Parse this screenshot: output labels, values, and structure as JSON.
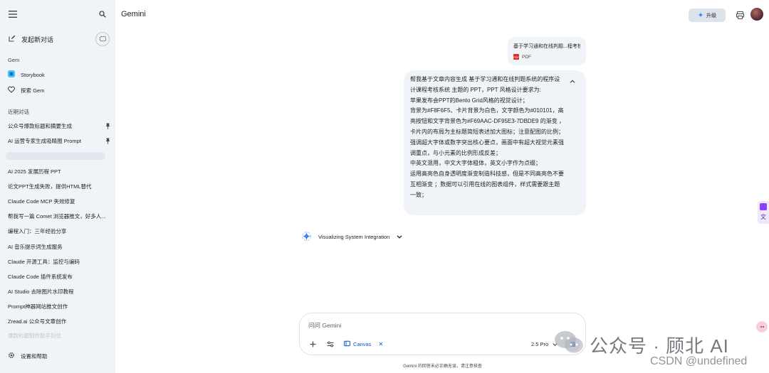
{
  "brand": "Gemini",
  "header": {
    "upgrade_label": "升级"
  },
  "sidebar": {
    "new_chat": "发起新对话",
    "gem_section": "Gem",
    "gems": [
      {
        "label": "Storybook"
      },
      {
        "label": "探索 Gem"
      }
    ],
    "recent_section": "近期对话",
    "pinned": [
      {
        "label": "公众号爆款标题和摘要生成"
      },
      {
        "label": "AI 运营专家生成吸睛图 Prompt"
      }
    ],
    "recent": [
      "AI 2025 发展历程 PPT",
      "论文PPT生成失败，提供HTML替代",
      "Claude Code MCP 失效修复",
      "帮我写一篇 Comet 浏览器推文，好多人...",
      "编程入门：三年经验分享",
      "AI 音乐提示词生成服务",
      "Claude 开源工具：监控与编码",
      "Claude Code 插件系统发布",
      "AI Studio 去除图片水印教程",
      "Prompt神器网站推文创作",
      "Zread.ai 公众号文章创作"
    ],
    "faded_item": "爆款标题制作助手封位",
    "settings": "设置和帮助"
  },
  "conversation": {
    "file": {
      "name": "基于学习通和在线判题...程考核",
      "type": "PDF"
    },
    "user_message": [
      "帮我基于文章内容生成 基于学习通和在线判题系统的程序设计课程考核系统 主题的 PPT，PPT 风格设计要求为:",
      "苹果发布会PPT的Bento Grid风格的视觉设计；",
      "背景为#F8F6F5、卡片背景为白色，文字颜色为#010101，高亮按钮和文字背景色为#F69AAC-DF95E3-7DBDE9 的渐变 ，卡片内的布局为主标题简短表述加大图标；注意配图的比例；",
      "强调超大字体或数字突出核心要点，画面中有超大视觉元素强调重点，与小元素的比例形成反差；",
      "中英文混用，中文大字体粗体，英文小字作为点缀；",
      "运用高亮色自身透明度渐变制造科技感，但是不同高亮色不要互相渐变 ；数据可以引用在线的图表组件，样式需要跟主题一致；"
    ],
    "thinking": "Visualizing System Integration"
  },
  "input": {
    "placeholder": "问问 Gemini",
    "tool_chip": "Canvas",
    "model": "2.5 Pro"
  },
  "disclaimer": "Gemini 的回答未必正确无误，请注意核查",
  "watermark": {
    "main": "公众号 · 顾北 AI",
    "csdn": "CSDN @undefined"
  }
}
